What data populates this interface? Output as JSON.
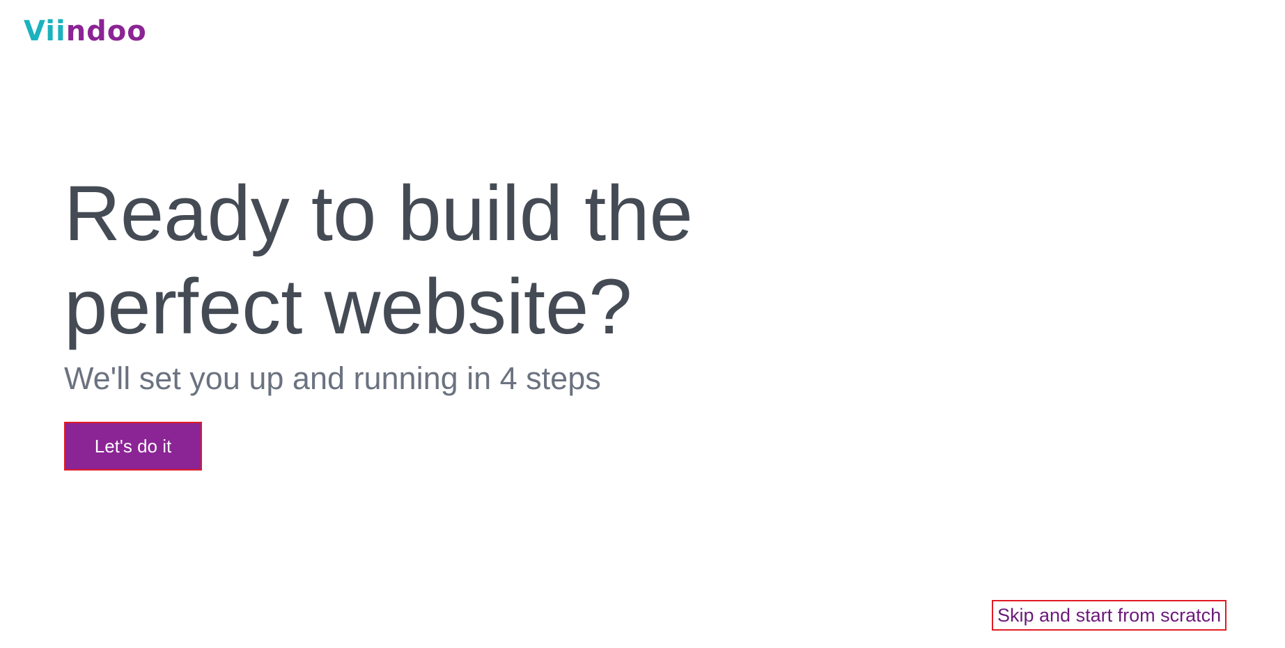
{
  "brand": {
    "logo_part1": "Vii",
    "logo_part2": "ndoo",
    "colors": {
      "teal": "#1ab2bf",
      "purple": "#8b2494"
    }
  },
  "hero": {
    "headline_line1": "Ready to build the",
    "headline_line2": "perfect website?",
    "subheadline": "We'll set you up and running in 4 steps"
  },
  "actions": {
    "start_label": "Let's do it",
    "skip_label": "Skip and start from scratch"
  }
}
